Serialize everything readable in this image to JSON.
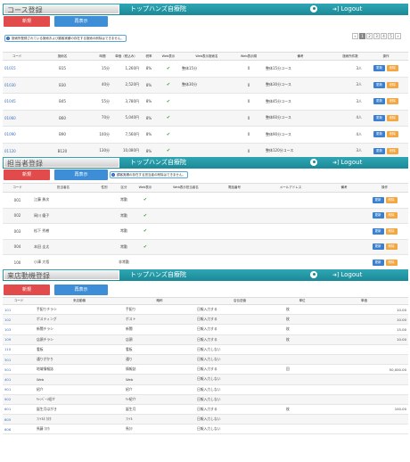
{
  "header": {
    "shop": "トップハンズ自療院",
    "logout": "Logout"
  },
  "buttons": {
    "new": "新規",
    "redisplay": "再表示",
    "edit": "更新",
    "delete": "削除"
  },
  "course": {
    "title": "コース登録",
    "note": "施術所登録されている施術および顧客実績の存在する施術の削除はできません。",
    "pager": [
      "«",
      "1",
      "2",
      "3",
      "4",
      "5",
      "»"
    ],
    "columns": [
      "コード",
      "施術名",
      "時間",
      "単価（税込み）",
      "税率",
      "Web表示",
      "Web表示施術名",
      "Web表示順",
      "備考",
      "施術所件数",
      "操作"
    ],
    "rows": [
      {
        "code": "01015",
        "name": "B15",
        "time": "15分",
        "price": "1,260円",
        "tax": "8%",
        "web": true,
        "webname": "整体15分",
        "order": "0",
        "note": "整体15分コース",
        "count": "3人"
      },
      {
        "code": "01030",
        "name": "B30",
        "time": "40分",
        "price": "2,520円",
        "tax": "8%",
        "web": true,
        "webname": "整体30分",
        "order": "0",
        "note": "整体30分コース",
        "count": "3人"
      },
      {
        "code": "01045",
        "name": "B45",
        "time": "55分",
        "price": "3,780円",
        "tax": "8%",
        "web": true,
        "webname": "",
        "order": "0",
        "note": "整体45分コース",
        "count": "3人"
      },
      {
        "code": "01060",
        "name": "B60",
        "time": "70分",
        "price": "5,040円",
        "tax": "8%",
        "web": true,
        "webname": "",
        "order": "0",
        "note": "整体60分コース",
        "count": "4人"
      },
      {
        "code": "01090",
        "name": "B90",
        "time": "100分",
        "price": "7,560円",
        "tax": "8%",
        "web": true,
        "webname": "",
        "order": "0",
        "note": "整体90分コース",
        "count": "4人"
      },
      {
        "code": "01120",
        "name": "B120",
        "time": "130分",
        "price": "10,080円",
        "tax": "8%",
        "web": true,
        "webname": "",
        "order": "0",
        "note": "整体120分コース",
        "count": "3人"
      }
    ]
  },
  "staff": {
    "title": "担当者登録",
    "note": "顧客実績の存在する担当者の削除はできません。",
    "columns": [
      "コード",
      "担当者名",
      "性別",
      "区分",
      "Web表示",
      "Web表示担当者名",
      "電話番号",
      "メールアドレス",
      "備考",
      "操作"
    ],
    "rows": [
      {
        "code": "001",
        "name": "江藤 勇次",
        "kubun": "常勤",
        "web": true
      },
      {
        "code": "002",
        "name": "岡川 優子",
        "kubun": "常勤",
        "web": true
      },
      {
        "code": "003",
        "name": "松下 秀樹",
        "kubun": "常勤",
        "web": true
      },
      {
        "code": "004",
        "name": "本田 圭太",
        "kubun": "常勤",
        "web": true
      },
      {
        "code": "100",
        "name": "小澤 大悟",
        "kubun": "非常勤",
        "web": false
      }
    ]
  },
  "reason": {
    "title": "来店動機登録",
    "columns": [
      "コード",
      "来店動機",
      "略称",
      "店伝送値",
      "単位",
      "単価"
    ],
    "rows": [
      {
        "code": "101",
        "name": "手配りチラシ",
        "abbr": "手配り",
        "input": "日報入力する",
        "unit": "枚",
        "price": "10.00"
      },
      {
        "code": "102",
        "name": "ポスティング",
        "abbr": "ポスト",
        "input": "日報入力する",
        "unit": "枚",
        "price": "10.00"
      },
      {
        "code": "103",
        "name": "新聞チラシ",
        "abbr": "新聞",
        "input": "日報入力する",
        "unit": "枚",
        "price": "15.00"
      },
      {
        "code": "109",
        "name": "店頭チラシ",
        "abbr": "店頭",
        "input": "日報入力する",
        "unit": "枚",
        "price": "10.00"
      },
      {
        "code": "110",
        "name": "看板",
        "abbr": "看板",
        "input": "日報入力しない",
        "unit": "",
        "price": ""
      },
      {
        "code": "301",
        "name": "通りがかり",
        "abbr": "通り",
        "input": "日報入力しない",
        "unit": "",
        "price": ""
      },
      {
        "code": "501",
        "name": "地域情報誌",
        "abbr": "情報誌",
        "input": "日報入力する",
        "unit": "回",
        "price": "50,000.00"
      },
      {
        "code": "401",
        "name": "Web",
        "abbr": "Web",
        "input": "日報入力しない",
        "unit": "",
        "price": ""
      },
      {
        "code": "901",
        "name": "紹介",
        "abbr": "紹介",
        "input": "日報入力しない",
        "unit": "",
        "price": ""
      },
      {
        "code": "902",
        "name": "ｷｬﾝﾍﾟｰﾝ紹介",
        "abbr": "ｷｬ紹介",
        "input": "日報入力しない",
        "unit": "",
        "price": ""
      },
      {
        "code": "601",
        "name": "誕生月はがき",
        "abbr": "誕生月",
        "input": "日報入力する",
        "unit": "枚",
        "price": "100.00"
      },
      {
        "code": "605",
        "name": "ﾌｧｲﾙﾈ ｶｸｶ",
        "abbr": "ﾌｧｲﾙ",
        "input": "日報入力しない",
        "unit": "",
        "price": ""
      },
      {
        "code": "606",
        "name": "馬藤 ｶｸｶ",
        "abbr": "馬ｶｸ",
        "input": "日報入力しない",
        "unit": "",
        "price": ""
      }
    ]
  }
}
